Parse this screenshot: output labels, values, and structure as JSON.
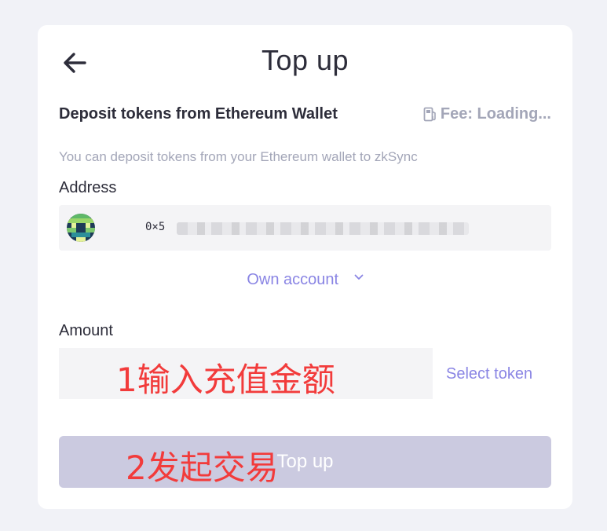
{
  "header": {
    "title": "Top up",
    "back_icon": "arrow-left-icon"
  },
  "deposit": {
    "subtitle": "Deposit tokens from Ethereum Wallet",
    "fee_label": "Fee: Loading...",
    "fee_icon": "fuel-pump-icon",
    "description": "You can deposit tokens from your Ethereum wallet to zkSync"
  },
  "address": {
    "label": "Address",
    "value_prefix": "0×5",
    "own_account_label": "Own account"
  },
  "amount": {
    "label": "Amount",
    "value": "",
    "select_token_label": "Select token"
  },
  "actions": {
    "topup_label": "Top up"
  },
  "annotations": {
    "step1": "1输入充值金额",
    "step2": "2发起交易"
  },
  "colors": {
    "accent": "#8a85e4",
    "button_disabled": "#cbcae0",
    "annotation": "#f23b3b"
  }
}
